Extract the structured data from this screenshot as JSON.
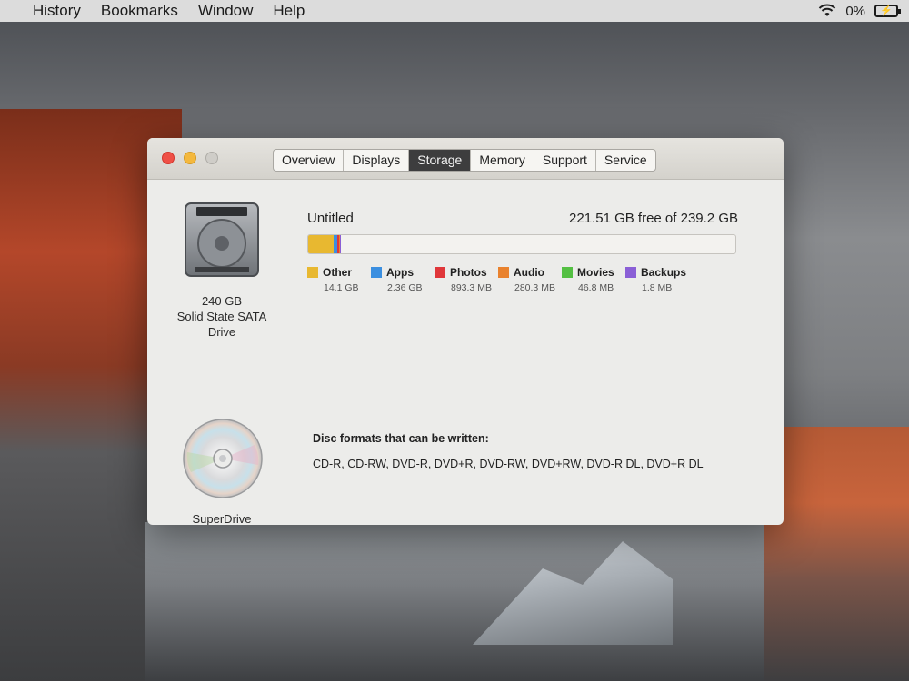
{
  "menubar": {
    "items": [
      "History",
      "Bookmarks",
      "Window",
      "Help"
    ],
    "battery_text": "0%"
  },
  "window": {
    "tabs": [
      "Overview",
      "Displays",
      "Storage",
      "Memory",
      "Support",
      "Service"
    ],
    "active_tab": "Storage",
    "drives": [
      {
        "label_lines": [
          "240 GB",
          "Solid State SATA",
          "Drive"
        ],
        "icon": "hard-drive-icon"
      },
      {
        "label_lines": [
          "SuperDrive"
        ],
        "icon": "optical-disc-icon"
      }
    ],
    "storage": {
      "volume_name": "Untitled",
      "free_text": "221.51 GB free of 239.2 GB",
      "total_gb": 239.2,
      "categories": [
        {
          "name": "Other",
          "size": "14.1 GB",
          "gb": 14.1,
          "color": "#e8b830"
        },
        {
          "name": "Apps",
          "size": "2.36 GB",
          "gb": 2.36,
          "color": "#3b8fe0"
        },
        {
          "name": "Photos",
          "size": "893.3 MB",
          "gb": 0.8933,
          "color": "#e0373a"
        },
        {
          "name": "Audio",
          "size": "280.3 MB",
          "gb": 0.2803,
          "color": "#e9822e"
        },
        {
          "name": "Movies",
          "size": "46.8 MB",
          "gb": 0.0468,
          "color": "#54c043"
        },
        {
          "name": "Backups",
          "size": "1.8 MB",
          "gb": 0.0018,
          "color": "#8a5fd6"
        }
      ]
    },
    "disc": {
      "title": "Disc formats that can be written:",
      "formats": "CD-R, CD-RW, DVD-R, DVD+R, DVD-RW, DVD+RW, DVD-R DL, DVD+R DL"
    }
  }
}
